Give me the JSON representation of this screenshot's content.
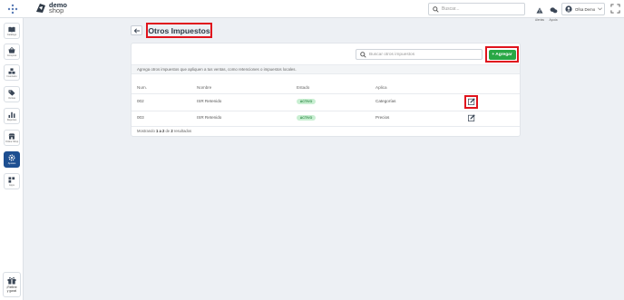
{
  "topbar": {
    "logo_line1": "demo",
    "logo_line2": "shop",
    "search_placeholder": "Buscar...",
    "icons": [
      {
        "name": "alerts-icon",
        "label": "Alertas"
      },
      {
        "name": "help-icon",
        "label": "Ayuda"
      }
    ],
    "user_name": "Ofsa Demo"
  },
  "sidebar": {
    "items": [
      {
        "name": "catalog",
        "icon": "book-icon",
        "label": "Catálogo",
        "active": false
      },
      {
        "name": "purchases",
        "icon": "basket-icon",
        "label": "Compras",
        "active": false
      },
      {
        "name": "inventory",
        "icon": "boxes-icon",
        "label": "Inventario",
        "active": false
      },
      {
        "name": "sales",
        "icon": "tag-icon",
        "label": "Ventas",
        "active": false
      },
      {
        "name": "reports",
        "icon": "bar-chart-icon",
        "label": "Reportes",
        "active": false
      },
      {
        "name": "online-store",
        "icon": "store-icon",
        "label": "Online Shop",
        "active": false
      },
      {
        "name": "settings",
        "icon": "gear-icon",
        "label": "Ajustes",
        "active": true
      },
      {
        "name": "apps",
        "icon": "apps-icon",
        "label": "Apps",
        "active": false
      }
    ],
    "refer_label_1": "¡Refiere",
    "refer_label_2": "y gana!"
  },
  "page": {
    "title": "Otros Impuestos"
  },
  "card": {
    "search_placeholder": "Buscar otros impuestos",
    "add_label": "+ Agregar",
    "description": "Agrega otros impuestos que apliquen a tus ventas, como retenciones o impuestos locales.",
    "columns": [
      "Num.",
      "Nombre",
      "Estado",
      "Aplica"
    ],
    "rows": [
      {
        "num": "002",
        "name": "ISR Retenido",
        "status": "ACTIVO",
        "applies": "Categorías"
      },
      {
        "num": "003",
        "name": "ISR Retenido",
        "status": "ACTIVO",
        "applies": "Precios"
      }
    ],
    "footer_prefix": "Mostrando",
    "footer_range": "1 a 2",
    "footer_of": "de",
    "footer_total": "2",
    "footer_suffix": "resultados"
  },
  "colors": {
    "accent": "#1d4f91",
    "success": "#28a745",
    "highlight": "#e0141d"
  }
}
